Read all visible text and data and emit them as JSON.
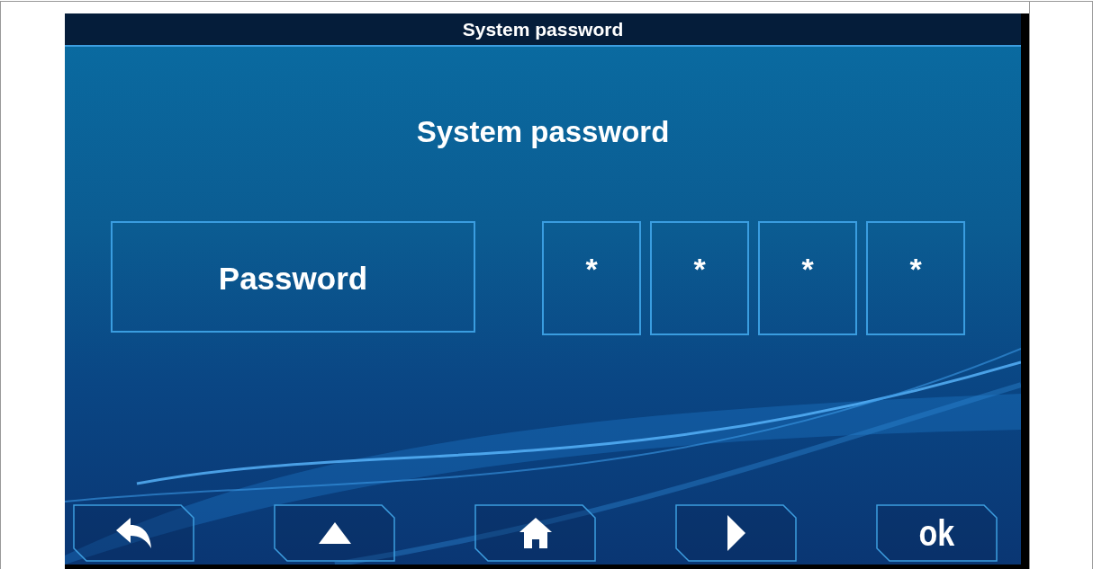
{
  "window": {
    "title": "System password"
  },
  "heading": "System password",
  "password_label": "Password",
  "digits": [
    "*",
    "*",
    "*",
    "*"
  ],
  "buttons": [
    {
      "kind": "back"
    },
    {
      "kind": "up"
    },
    {
      "kind": "home"
    },
    {
      "kind": "right"
    },
    {
      "kind": "ok",
      "label": "ok"
    }
  ]
}
